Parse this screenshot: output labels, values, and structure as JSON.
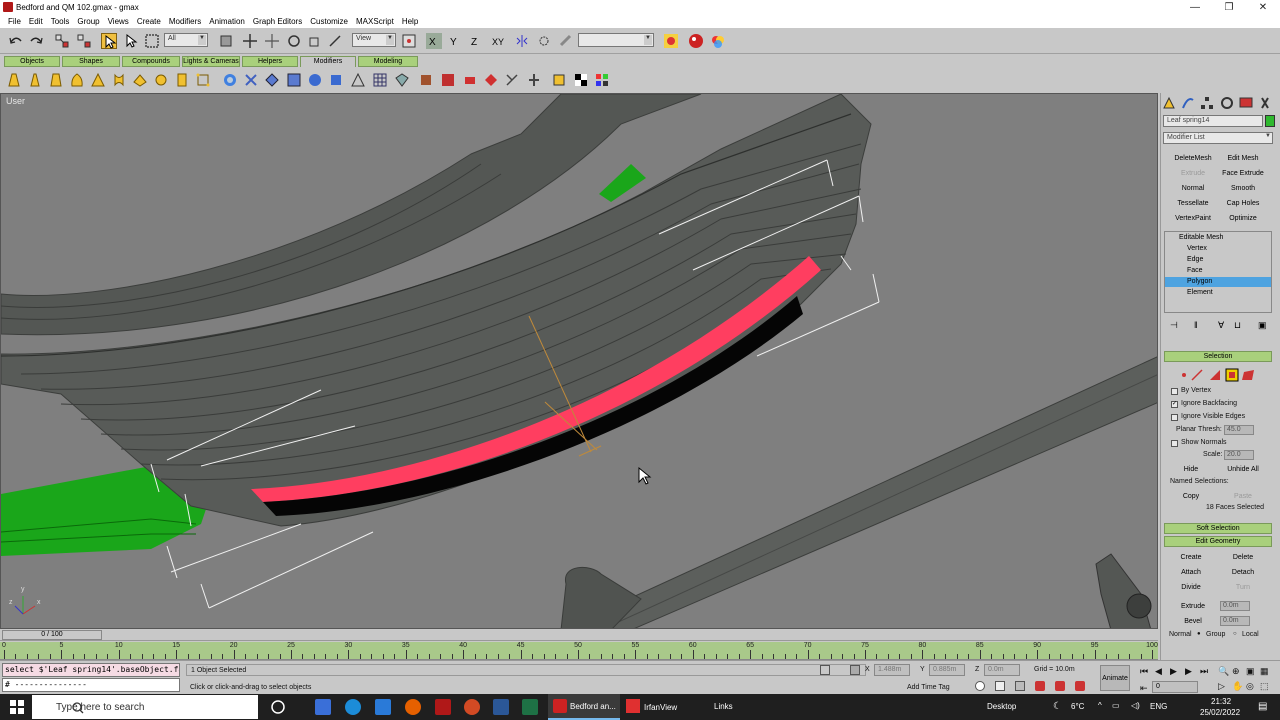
{
  "window": {
    "title": "Bedford and QM 102.gmax - gmax",
    "controls": [
      "—",
      "❐",
      "✕"
    ]
  },
  "menu": [
    "File",
    "Edit",
    "Tools",
    "Group",
    "Views",
    "Create",
    "Modifiers",
    "Animation",
    "Graph Editors",
    "Customize",
    "MAXScript",
    "Help"
  ],
  "toolbar": {
    "selection_filter": "All",
    "ref_coord": "View",
    "named_set": ""
  },
  "tabs": [
    {
      "label": "Objects",
      "selected": false
    },
    {
      "label": "Shapes",
      "selected": false
    },
    {
      "label": "Compounds",
      "selected": false
    },
    {
      "label": "Lights & Cameras",
      "selected": false
    },
    {
      "label": "Helpers",
      "selected": false
    },
    {
      "label": "Modifiers",
      "selected": true
    },
    {
      "label": "Modeling",
      "selected": false
    }
  ],
  "viewport": {
    "label": "User",
    "axis_x": "x",
    "axis_y": "y",
    "axis_z": "z"
  },
  "command_panel": {
    "object_name": "Leaf spring14",
    "object_color": "#2eb82e",
    "modifier_list": "Modifier List",
    "buttons": [
      {
        "label": "DeleteMesh",
        "disabled": false
      },
      {
        "label": "Edit Mesh",
        "disabled": false
      },
      {
        "label": "Extrude",
        "disabled": true
      },
      {
        "label": "Face Extrude",
        "disabled": false
      },
      {
        "label": "Normal",
        "disabled": false
      },
      {
        "label": "Smooth",
        "disabled": false
      },
      {
        "label": "Tessellate",
        "disabled": false
      },
      {
        "label": "Cap Holes",
        "disabled": false
      },
      {
        "label": "VertexPaint",
        "disabled": false
      },
      {
        "label": "Optimize",
        "disabled": false
      }
    ],
    "stack": [
      {
        "label": "Editable Mesh",
        "root": true,
        "selected": false
      },
      {
        "label": "Vertex",
        "root": false,
        "selected": false
      },
      {
        "label": "Edge",
        "root": false,
        "selected": false
      },
      {
        "label": "Face",
        "root": false,
        "selected": false
      },
      {
        "label": "Polygon",
        "root": false,
        "selected": true
      },
      {
        "label": "Element",
        "root": false,
        "selected": false
      }
    ],
    "selection": {
      "title": "Selection",
      "by_vertex": "By Vertex",
      "ignore_backfacing": "Ignore Backfacing",
      "ignore_visible_edges": "Ignore Visible Edges",
      "planar_thresh_label": "Planar Thresh:",
      "planar_thresh_value": "45.0",
      "show_normals": "Show Normals",
      "scale_label": "Scale:",
      "scale_value": "20.0",
      "hide": "Hide",
      "unhide_all": "Unhide All",
      "named_selections": "Named Selections:",
      "copy": "Copy",
      "paste": "Paste",
      "count": "18 Faces Selected"
    },
    "soft_selection": "Soft Selection",
    "edit_geometry": {
      "title": "Edit Geometry",
      "create": "Create",
      "delete": "Delete",
      "attach": "Attach",
      "detach": "Detach",
      "divide": "Divide",
      "turn": "Turn",
      "extrude": "Extrude",
      "extrude_value": "0.0m",
      "bevel": "Bevel",
      "bevel_value": "0.0m",
      "normal": "Normal",
      "group": "Group",
      "local": "Local"
    }
  },
  "timeline": {
    "slider": "0 / 100",
    "ticks": [
      "0",
      "5",
      "10",
      "15",
      "20",
      "25",
      "30",
      "35",
      "40",
      "45",
      "50",
      "55",
      "60",
      "65",
      "70",
      "75",
      "80",
      "85",
      "90",
      "95",
      "100"
    ]
  },
  "status": {
    "maxscript_line1": "select $'Leaf spring14'.baseObject.fac",
    "maxscript_line2": "# ---------------",
    "selected": "1 Object Selected",
    "prompt": "Click or click-and-drag to select objects",
    "x_label": "X",
    "x_value": "1.488m",
    "y_label": "Y",
    "y_value": "0.885m",
    "z_label": "Z",
    "z_value": "0.0m",
    "grid": "Grid = 10.0m",
    "add_time_tag": "Add Time Tag",
    "animate": "Animate",
    "frame": "0"
  },
  "taskbar": {
    "search_placeholder": "Type here to search",
    "apps": [
      {
        "label": "Bedford an...",
        "active": true
      },
      {
        "label": "IrfanView",
        "active": false
      }
    ],
    "links": "Links",
    "desktop": "Desktop",
    "weather": "6°C",
    "lang": "ENG",
    "time": "21:32",
    "date": "25/02/2022"
  }
}
